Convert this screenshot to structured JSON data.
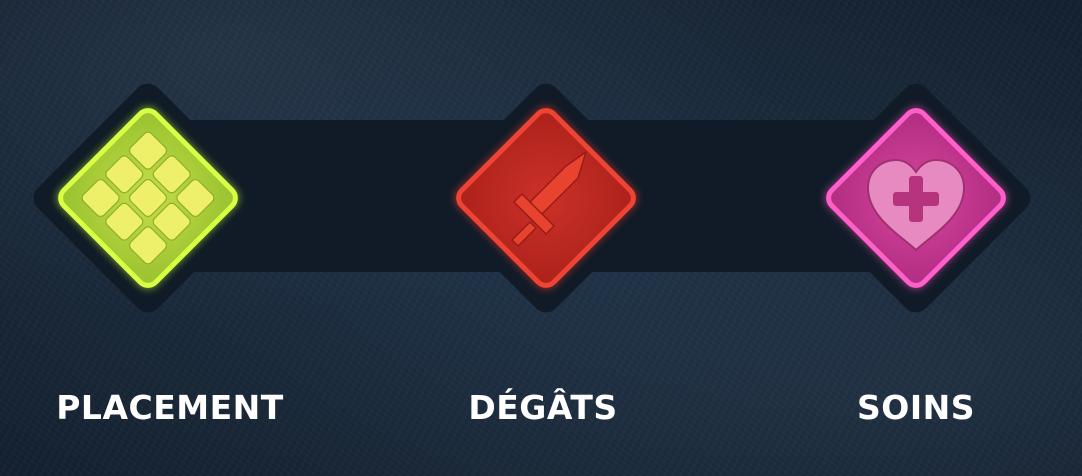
{
  "abilities": [
    {
      "label": "PLACEMENT",
      "icon": "grid-tiles-icon",
      "color": "#b9e52b"
    },
    {
      "label": "DÉGÂTS",
      "icon": "sword-icon",
      "color": "#d8372a"
    },
    {
      "label": "SOINS",
      "icon": "heart-plus-icon",
      "color": "#e0469e"
    }
  ]
}
